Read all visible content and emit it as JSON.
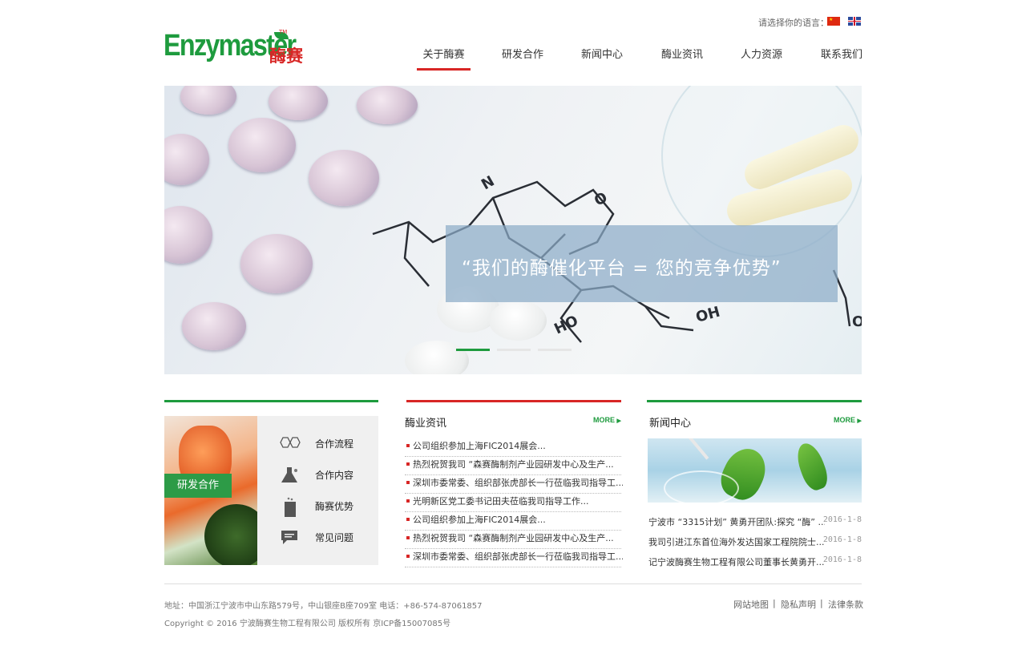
{
  "header": {
    "language_label": "请选择你的语言：",
    "logo": {
      "text_en": "Enzymaster",
      "text_cn": "酶赛",
      "tm": "TM"
    },
    "nav": [
      {
        "label": "关于酶赛",
        "active": true
      },
      {
        "label": "研发合作",
        "active": false
      },
      {
        "label": "新闻中心",
        "active": false
      },
      {
        "label": "酶业资讯",
        "active": false
      },
      {
        "label": "人力资源",
        "active": false
      },
      {
        "label": "联系我们",
        "active": false
      }
    ]
  },
  "banner": {
    "quote": "“我们的酶催化平台 = 您的竞争优势”",
    "slides": 3,
    "active_slide": 1,
    "colors": {
      "active_dot": "#1e9b3e",
      "inactive_dot": "#e6e6e6"
    }
  },
  "rd": {
    "label": "研发合作",
    "items": [
      {
        "label": "合作流程",
        "icon": "molecule-icon"
      },
      {
        "label": "合作内容",
        "icon": "flask-icon"
      },
      {
        "label": "酶赛优势",
        "icon": "beaker-icon"
      },
      {
        "label": "常见问题",
        "icon": "chat-icon"
      }
    ]
  },
  "industry": {
    "title": "酶业资讯",
    "more": "MORE",
    "items": [
      "公司组织参加上海FIC2014展会...",
      "热烈祝贺我司 “森赛酶制剂产业园研发中心及生产...",
      "深圳市委常委、组织部张虎部长一行莅临我司指导工...",
      "光明新区党工委书记田夫莅临我司指导工作...",
      "公司组织参加上海FIC2014展会...",
      "热烈祝贺我司 “森赛酶制剂产业园研发中心及生产...",
      "深圳市委常委、组织部张虎部长一行莅临我司指导工..."
    ]
  },
  "news": {
    "title": "新闻中心",
    "more": "MORE",
    "items": [
      {
        "title": "宁波市 “3315计划” 黄勇开团队:探究 “酶” ...",
        "date": "2016-1-8"
      },
      {
        "title": "我司引进江东首位海外发达国家工程院院士...",
        "date": "2016-1-8"
      },
      {
        "title": "记宁波酶赛生物工程有限公司董事长黄勇开...",
        "date": "2016-1-8"
      }
    ]
  },
  "footer": {
    "address": "地址：中国浙江宁波市中山东路579号，中山银座B座709室  电话：+86-574-87061857",
    "copyright": "Copyright © 2016 宁波酶赛生物工程有限公司 版权所有   京ICP备15007085号",
    "links": [
      "网站地图",
      "隐私声明",
      "法律条款"
    ]
  },
  "colors": {
    "brand_green": "#1e9b3e",
    "brand_red": "#d82625"
  }
}
